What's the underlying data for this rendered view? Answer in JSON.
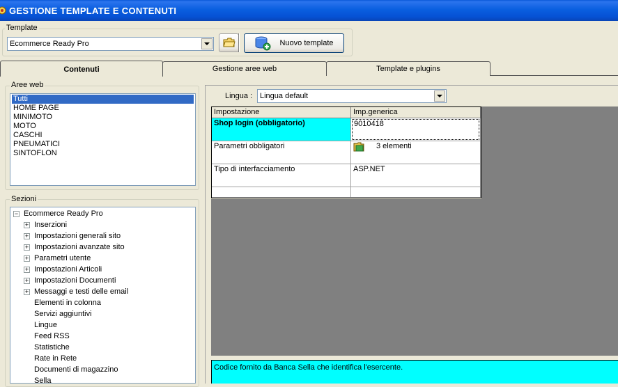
{
  "window": {
    "title": "GESTIONE TEMPLATE E CONTENUTI"
  },
  "template": {
    "group_label": "Template",
    "selected": "Ecommerce Ready Pro",
    "new_button_label": "Nuovo template"
  },
  "tabs": [
    {
      "label": "Contenuti",
      "active": true
    },
    {
      "label": "Gestione aree web",
      "active": false
    },
    {
      "label": "Template e plugins",
      "active": false
    }
  ],
  "aree_web": {
    "group_label": "Aree web",
    "items": [
      "Tutti",
      "HOME PAGE",
      "MINIMOTO",
      "MOTO",
      "CASCHI",
      "PNEUMATICI",
      "SINTOFLON"
    ],
    "selected_index": 0
  },
  "sezioni": {
    "group_label": "Sezioni",
    "root": "Ecommerce Ready Pro",
    "children": [
      {
        "label": "Inserzioni",
        "expandable": true
      },
      {
        "label": "Impostazioni generali sito",
        "expandable": true
      },
      {
        "label": "Impostazioni avanzate sito",
        "expandable": true
      },
      {
        "label": "Parametri utente",
        "expandable": true
      },
      {
        "label": "Impostazioni Articoli",
        "expandable": true
      },
      {
        "label": "Impostazioni Documenti",
        "expandable": true
      },
      {
        "label": "Messaggi e testi delle email",
        "expandable": true
      },
      {
        "label": "Elementi in colonna",
        "expandable": false
      },
      {
        "label": "Servizi aggiuntivi",
        "expandable": false
      },
      {
        "label": "Lingue",
        "expandable": false
      },
      {
        "label": "Feed RSS",
        "expandable": false
      },
      {
        "label": "Statistiche",
        "expandable": false
      },
      {
        "label": "Rate in Rete",
        "expandable": false
      },
      {
        "label": "Documenti di magazzino",
        "expandable": false
      },
      {
        "label": "Sella",
        "expandable": false
      }
    ]
  },
  "lingua": {
    "label": "Lingua :",
    "selected": "Lingua default"
  },
  "grid": {
    "headers": [
      "Impostazione",
      "Imp.generica"
    ],
    "rows": [
      {
        "setting": "Shop login (obbligatorio)",
        "value": "9010418"
      },
      {
        "setting": "Parametri obbligatori",
        "value": "3 elementi"
      },
      {
        "setting": "Tipo di interfacciamento",
        "value": "ASP.NET"
      },
      {
        "setting": "",
        "value": ""
      }
    ]
  },
  "description": "Codice fornito da Banca Sella che identifica l'esercente.",
  "colors": {
    "selected_row": "#00ffff",
    "list_selection": "#316ac5",
    "titlebar": "#0651d4",
    "empty_area": "#808080"
  }
}
